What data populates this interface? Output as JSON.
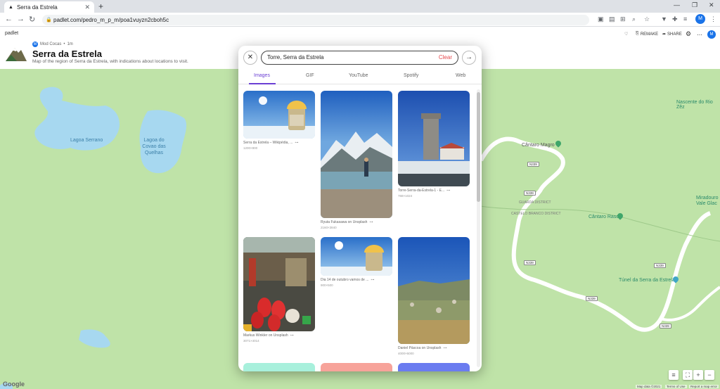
{
  "browser": {
    "tab_title": "Serra da Estrela",
    "url": "padlet.com/pedro_m_p_m/poa1vuyzn2cboh5c",
    "profile_initial": "M"
  },
  "padlet": {
    "brand": "padlet",
    "author": "Mod Cocas",
    "time": "1m",
    "title": "Serra da Estrela",
    "description": "Map of the region of Serra da Estrela, with indications about locations to visit.",
    "remake_label": "REMAKE",
    "share_label": "SHARE",
    "profile_initial": "M"
  },
  "modal": {
    "search_value": "Torre, Serra da Estrela",
    "clear_label": "Clear",
    "tabs": [
      "Images",
      "GIF",
      "YouTube",
      "Spotify",
      "Web"
    ],
    "active_tab": "Images",
    "results": [
      {
        "caption": "Serra da Estrela – Wikipédia, ...",
        "dims": "1200×800"
      },
      {
        "caption": "Ryuta Fukasawa on Unsplash",
        "dims": "2160×3840"
      },
      {
        "caption": "Torre-Serra-da-Estrela-1 - E...",
        "dims": "768×1024"
      },
      {
        "caption": "Markus Winkler on Unsplash",
        "dims": "3071×4014"
      },
      {
        "caption": "Dia 14 de outubro vamos de ...",
        "dims": "900×500"
      },
      {
        "caption": "Daniel Páscoa on Unsplash",
        "dims": "4000×6000"
      }
    ]
  },
  "map": {
    "labels": {
      "lagoa_serrano": "Lagoa Serrano",
      "lagoa_covao": "Lagoa do Covao das Quelhas",
      "nascente": "Nascente do Rio Zêz",
      "cantaro_magro": "Cântaro Magro",
      "cantaro_raso": "Cântaro Raso",
      "guarda_district": "GUARDA DISTRICT",
      "castelo_branco_district": "CASTELO BRANCO DISTRICT",
      "miradouro": "Miradouro Vale Glac",
      "tunel": "Túnel da Serra da Estrela"
    },
    "road": "N339",
    "google": "Google",
    "footer": [
      "Map data ©2021",
      "Terms of Use",
      "Report a map error"
    ]
  }
}
